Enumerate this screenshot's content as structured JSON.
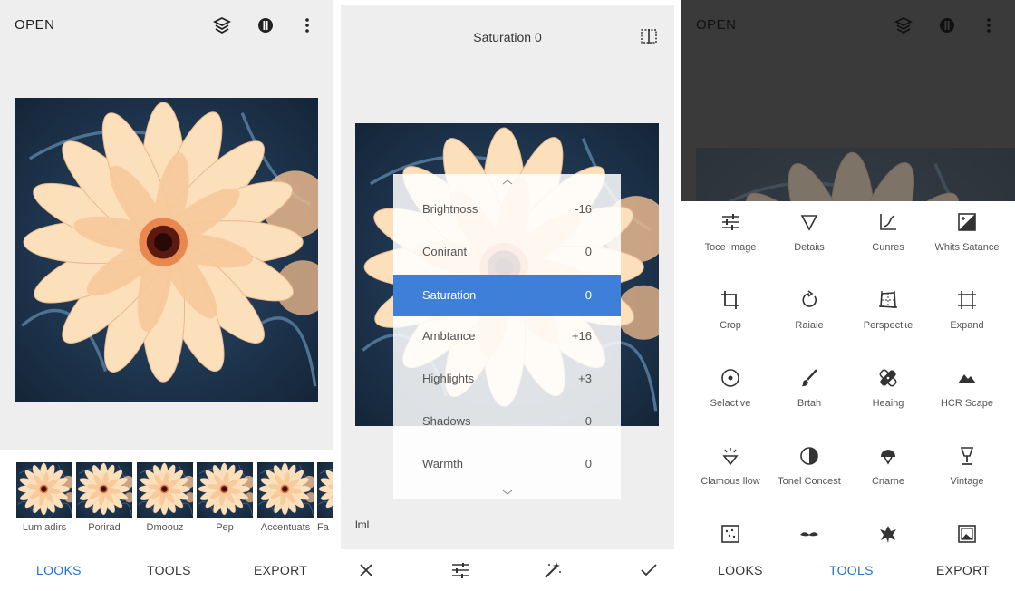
{
  "looks_screen": {
    "open_label": "OPEN",
    "icons": [
      "layers-icon",
      "info-icon",
      "more-vert-icon"
    ],
    "looks": [
      {
        "label": "Lum adirs"
      },
      {
        "label": "Porirad"
      },
      {
        "label": "Dmoouz"
      },
      {
        "label": "Pep"
      },
      {
        "label": "Accentuats"
      },
      {
        "label": "Fa"
      }
    ],
    "nav": {
      "looks": "LOOKS",
      "tools": "TOOLS",
      "export": "EXPORT",
      "active": "LOOKS"
    }
  },
  "tune_screen": {
    "title": "Saturation 0",
    "compare_icon": "compare-icon",
    "adjustments": [
      {
        "name": "Brightnoss",
        "value": "-16",
        "selected": false
      },
      {
        "name": "Conirant",
        "value": "0",
        "selected": false
      },
      {
        "name": "Saturation",
        "value": "0",
        "selected": true
      },
      {
        "name": "Ambtance",
        "value": "+16",
        "selected": false
      },
      {
        "name": "Highlights",
        "value": "+3",
        "selected": false
      },
      {
        "name": "Shadows",
        "value": "0",
        "selected": false
      },
      {
        "name": "Warmth",
        "value": "0",
        "selected": false
      }
    ],
    "histogram_label": "lml",
    "bottom_icons": [
      "close-icon",
      "tune-icon",
      "auto-icon",
      "check-icon"
    ]
  },
  "tools_screen": {
    "open_label": "OPEN",
    "tools": [
      {
        "label": "Toce Image",
        "icon": "tune-image-icon"
      },
      {
        "label": "Detaiɩs",
        "icon": "details-icon"
      },
      {
        "label": "Cunres",
        "icon": "curves-icon"
      },
      {
        "label": "Whits Satance",
        "icon": "white-balance-icon"
      },
      {
        "label": "Crop",
        "icon": "crop-icon"
      },
      {
        "label": "Raiaie",
        "icon": "rotate-icon"
      },
      {
        "label": "Perspectiɩe",
        "icon": "perspective-icon"
      },
      {
        "label": "Expand",
        "icon": "expand-icon"
      },
      {
        "label": "Selactive",
        "icon": "selective-icon"
      },
      {
        "label": "Brtah",
        "icon": "brush-icon"
      },
      {
        "label": "Heaing",
        "icon": "healing-icon"
      },
      {
        "label": "HCR Scape",
        "icon": "hdr-scape-icon"
      },
      {
        "label": "Clamous Ɩlow",
        "icon": "glamour-glow-icon"
      },
      {
        "label": "Tonel Concest",
        "icon": "tonal-contrast-icon"
      },
      {
        "label": "Cnarne",
        "icon": "drama-icon"
      },
      {
        "label": "Vintage",
        "icon": "vintage-icon"
      },
      {
        "label": "",
        "icon": "grainy-film-icon"
      },
      {
        "label": "",
        "icon": "retrolux-icon"
      },
      {
        "label": "",
        "icon": "grunge-icon"
      },
      {
        "label": "",
        "icon": "frames-icon"
      }
    ],
    "nav": {
      "looks": "LOOKS",
      "tools": "TOOLS",
      "export": "EXPORT",
      "active": "TOOLS"
    }
  },
  "colors": {
    "accent": "#1e6fd0",
    "selected_row": "#3d7fd9",
    "panel_gray": "#eeeeee",
    "dim_overlay": "#3a3a3a"
  }
}
